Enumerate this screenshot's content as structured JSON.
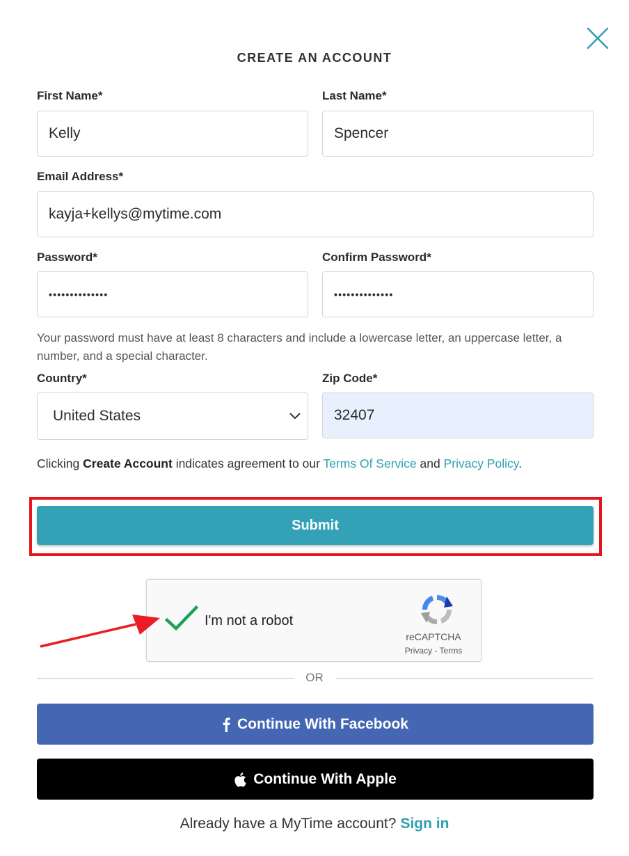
{
  "modal": {
    "title": "CREATE AN ACCOUNT",
    "close_icon": "close-icon"
  },
  "form": {
    "first_name": {
      "label": "First Name*",
      "value": "Kelly"
    },
    "last_name": {
      "label": "Last Name*",
      "value": "Spencer"
    },
    "email": {
      "label": "Email Address*",
      "value": "kayja+kellys@mytime.com"
    },
    "password": {
      "label": "Password*",
      "value": "••••••••••••••"
    },
    "confirm_password": {
      "label": "Confirm Password*",
      "value": "••••••••••••••"
    },
    "password_hint": "Your password must have at least 8 characters and include a lowercase letter, an uppercase letter, a number, and a special character.",
    "country": {
      "label": "Country*",
      "value": "United States"
    },
    "zip": {
      "label": "Zip Code*",
      "value": "32407"
    }
  },
  "terms": {
    "prefix": "Clicking ",
    "bold": "Create Account",
    "middle": " indicates agreement to our ",
    "tos_link": "Terms Of Service",
    "and": " and ",
    "privacy_link": "Privacy Policy",
    "suffix": "."
  },
  "submit": {
    "label": "Submit"
  },
  "recaptcha": {
    "label": "I'm not a robot",
    "brand": "reCAPTCHA",
    "links": "Privacy - Terms",
    "checked": true
  },
  "divider": {
    "label": "OR"
  },
  "social": {
    "facebook": {
      "label": "Continue With Facebook",
      "icon": "facebook-icon"
    },
    "apple": {
      "label": "Continue With Apple",
      "icon": "apple-icon"
    }
  },
  "signin": {
    "prompt": "Already have a MyTime account?",
    "link": "Sign in"
  },
  "colors": {
    "accent": "#33a1b6",
    "link": "#2e9fb1",
    "facebook": "#4466b3",
    "apple": "#000000",
    "highlight": "#e8141a",
    "autofill": "#e8f0fe"
  }
}
